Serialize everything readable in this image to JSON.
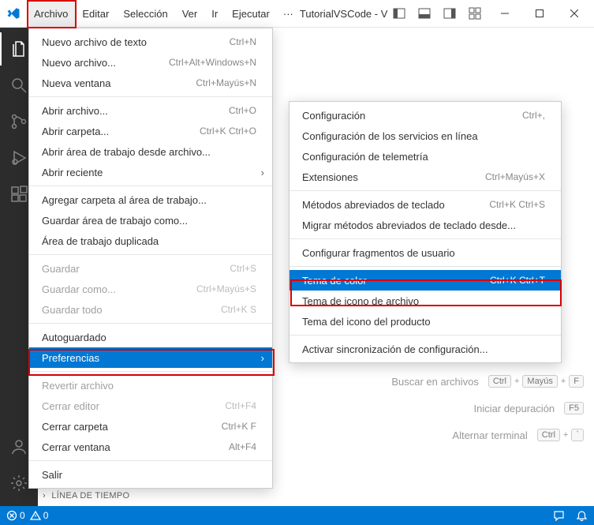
{
  "app": {
    "title": "TutorialVSCode - Visual S…"
  },
  "menubar": {
    "archivo": "Archivo",
    "editar": "Editar",
    "seleccion": "Selección",
    "ver": "Ver",
    "ir": "Ir",
    "ejecutar": "Ejecutar",
    "overflow": "···"
  },
  "fileMenu": {
    "newTextFile": {
      "label": "Nuevo archivo de texto",
      "shortcut": "Ctrl+N"
    },
    "newFile": {
      "label": "Nuevo archivo...",
      "shortcut": "Ctrl+Alt+Windows+N"
    },
    "newWindow": {
      "label": "Nueva ventana",
      "shortcut": "Ctrl+Mayús+N"
    },
    "openFile": {
      "label": "Abrir archivo...",
      "shortcut": "Ctrl+O"
    },
    "openFolder": {
      "label": "Abrir carpeta...",
      "shortcut": "Ctrl+K Ctrl+O"
    },
    "openWorkspaceFile": {
      "label": "Abrir área de trabajo desde archivo..."
    },
    "openRecent": {
      "label": "Abrir reciente"
    },
    "addFolder": {
      "label": "Agregar carpeta al área de trabajo..."
    },
    "saveWorkspaceAs": {
      "label": "Guardar área de trabajo como..."
    },
    "duplicateWorkspace": {
      "label": "Área de trabajo duplicada"
    },
    "save": {
      "label": "Guardar",
      "shortcut": "Ctrl+S"
    },
    "saveAs": {
      "label": "Guardar como...",
      "shortcut": "Ctrl+Mayús+S"
    },
    "saveAll": {
      "label": "Guardar todo",
      "shortcut": "Ctrl+K S"
    },
    "autoSave": {
      "label": "Autoguardado"
    },
    "preferences": {
      "label": "Preferencias"
    },
    "revertFile": {
      "label": "Revertir archivo"
    },
    "closeEditor": {
      "label": "Cerrar editor",
      "shortcut": "Ctrl+F4"
    },
    "closeFolder": {
      "label": "Cerrar carpeta",
      "shortcut": "Ctrl+K F"
    },
    "closeWindow": {
      "label": "Cerrar ventana",
      "shortcut": "Alt+F4"
    },
    "exit": {
      "label": "Salir"
    }
  },
  "prefsMenu": {
    "settings": {
      "label": "Configuración",
      "shortcut": "Ctrl+,"
    },
    "onlineServices": {
      "label": "Configuración de los servicios en línea"
    },
    "telemetry": {
      "label": "Configuración de telemetría"
    },
    "extensions": {
      "label": "Extensiones",
      "shortcut": "Ctrl+Mayús+X"
    },
    "keyboardShortcuts": {
      "label": "Métodos abreviados de teclado",
      "shortcut": "Ctrl+K Ctrl+S"
    },
    "migrateShortcuts": {
      "label": "Migrar métodos abreviados de teclado desde..."
    },
    "userSnippets": {
      "label": "Configurar fragmentos de usuario"
    },
    "colorTheme": {
      "label": "Tema de color",
      "shortcut": "Ctrl+K Ctrl+T"
    },
    "fileIconTheme": {
      "label": "Tema de icono de archivo"
    },
    "productIconTheme": {
      "label": "Tema del icono del producto"
    },
    "settingsSync": {
      "label": "Activar sincronización de configuración..."
    }
  },
  "welcomeHints": {
    "findInFiles": {
      "label": "Buscar en archivos",
      "keys": [
        "Ctrl",
        "+",
        "Mayús",
        "+",
        "F"
      ]
    },
    "startDebug": {
      "label": "Iniciar depuración",
      "keys": [
        "F5"
      ]
    },
    "toggleTerm": {
      "label": "Alternar terminal",
      "keys": [
        "Ctrl",
        "+",
        "`"
      ]
    }
  },
  "sidebar": {
    "timeline": "LÍNEA DE TIEMPO"
  },
  "statusbar": {
    "errors": "0",
    "warnings": "0"
  }
}
